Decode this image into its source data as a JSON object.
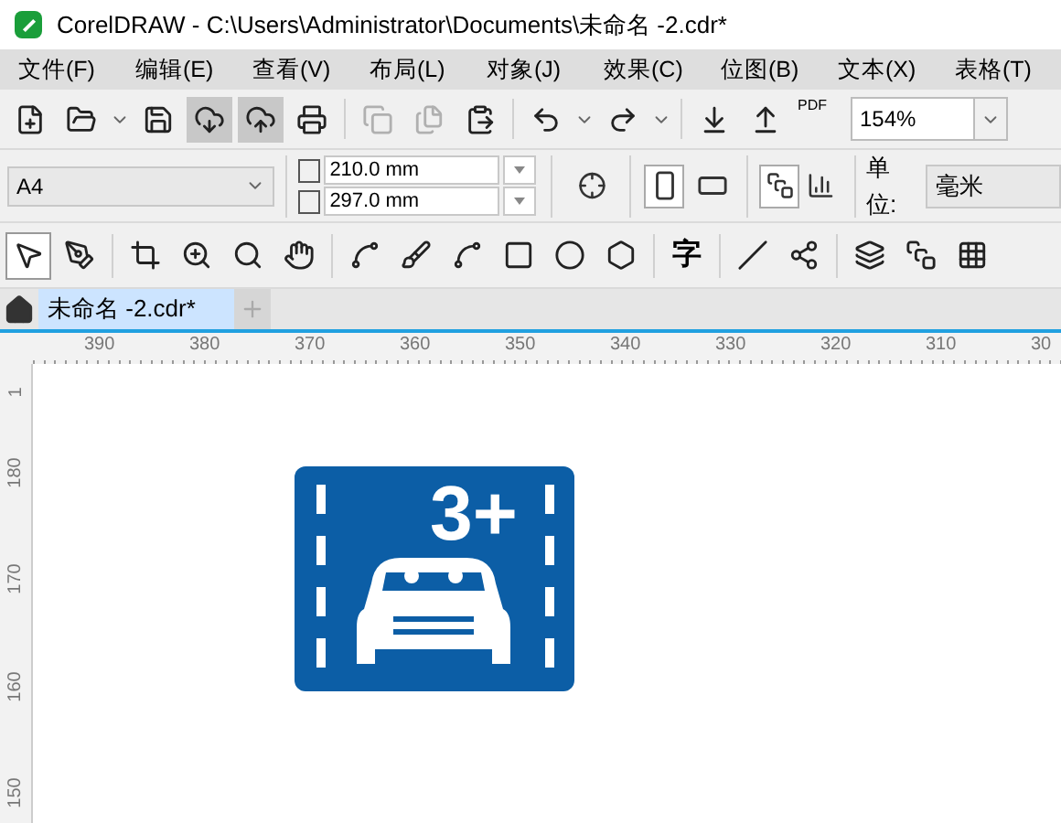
{
  "window": {
    "title": "CorelDRAW - C:\\Users\\Administrator\\Documents\\未命名 -2.cdr*"
  },
  "menu": [
    "文件(F)",
    "编辑(E)",
    "查看(V)",
    "布局(L)",
    "对象(J)",
    "效果(C)",
    "位图(B)",
    "文本(X)",
    "表格(T)"
  ],
  "standard_toolbar": [
    {
      "pressed": false,
      "disabled": false
    },
    {
      "pressed": false,
      "disabled": false
    },
    {
      "pressed": false,
      "disabled": false
    },
    {
      "pressed": true,
      "disabled": false
    },
    {
      "pressed": true,
      "disabled": false
    },
    {
      "pressed": false,
      "disabled": false
    },
    {
      "pressed": false,
      "disabled": true
    },
    {
      "pressed": false,
      "disabled": true
    },
    {
      "pressed": false,
      "disabled": false
    },
    {
      "pressed": false,
      "disabled": false
    },
    {
      "pressed": false,
      "disabled": false
    },
    {
      "pressed": false,
      "disabled": false
    },
    {
      "pressed": false,
      "disabled": false
    }
  ],
  "pdf_label": "PDF",
  "zoom": {
    "value": "154%"
  },
  "page_size": {
    "value": "A4"
  },
  "page_width": {
    "value": "210.0 mm"
  },
  "page_height": {
    "value": "297.0 mm"
  },
  "orientation": [
    {
      "selected": true
    },
    {
      "selected": false
    }
  ],
  "units": {
    "label": "单位:",
    "value": "毫米"
  },
  "toolbox": [
    {
      "selected": true
    },
    {
      "selected": false
    },
    {
      "selected": false
    },
    {
      "selected": false
    },
    {
      "selected": false
    },
    {
      "selected": false
    },
    {
      "selected": false
    },
    {
      "selected": false
    },
    {
      "selected": false
    },
    {
      "selected": false
    },
    {
      "selected": false
    },
    {
      "selected": false
    },
    {
      "selected": false
    },
    {
      "selected": false
    },
    {
      "selected": false
    },
    {
      "selected": false
    },
    {
      "selected": false
    },
    {
      "selected": false
    }
  ],
  "text_tool_label": "字",
  "document_tabs": [
    {
      "label": "未命名 -2.cdr*",
      "selected": true
    }
  ],
  "horizontal_ruler": [
    "390",
    "380",
    "370",
    "360",
    "350",
    "340",
    "330",
    "320",
    "310",
    "30"
  ],
  "vertical_ruler": [
    "1",
    "180",
    "170",
    "160",
    "150"
  ],
  "sign": {
    "text": "3+"
  }
}
